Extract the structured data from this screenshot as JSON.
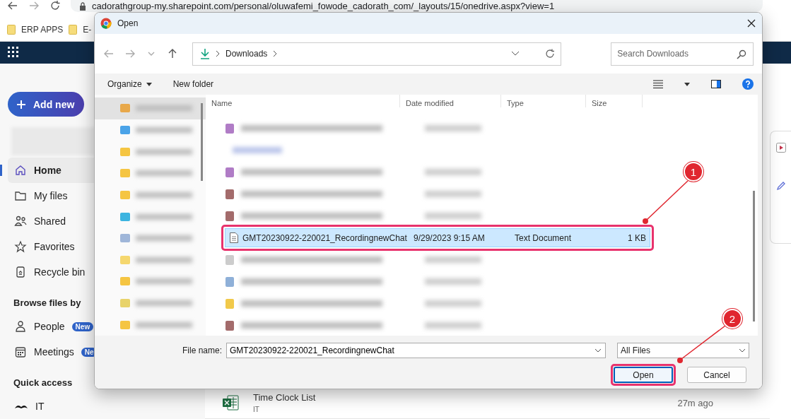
{
  "browser": {
    "url": "cadorathgroup-my.sharepoint.com/personal/oluwafemi_fowode_cadorath_com/_layouts/15/onedrive.aspx?view=1",
    "bookmarks": [
      "ERP APPS",
      "E-"
    ]
  },
  "sidebar": {
    "add_button": "Add new",
    "nav": [
      {
        "label": "Home",
        "selected": true
      },
      {
        "label": "My files",
        "selected": false
      },
      {
        "label": "Shared",
        "selected": false
      },
      {
        "label": "Favorites",
        "selected": false
      },
      {
        "label": "Recycle bin",
        "selected": false
      }
    ],
    "browse_heading": "Browse files by",
    "browse": [
      {
        "label": "People",
        "badge": "New"
      },
      {
        "label": "Meetings",
        "badge": "Ne"
      }
    ],
    "quick_heading": "Quick access",
    "quick": [
      {
        "label": "IT"
      }
    ]
  },
  "content": {
    "rows": [
      {
        "name": "Time Clock List",
        "location": "IT",
        "time": "27m ago"
      }
    ]
  },
  "dialog": {
    "title": "Open",
    "path": "Downloads",
    "search_placeholder": "Search Downloads",
    "toolbar": [
      "Organize",
      "New folder"
    ],
    "nav_pane": [
      {
        "color": "#e8a84a",
        "selected": true
      },
      {
        "color": "#4aa3e8",
        "selected": false
      },
      {
        "color": "#f5c542",
        "selected": false
      },
      {
        "color": "#f5c542",
        "selected": false
      },
      {
        "color": "#f5c542",
        "selected": false
      },
      {
        "color": "#3cb4e0",
        "selected": false
      },
      {
        "color": "#9fb6d9",
        "selected": false
      },
      {
        "color": "#f5d76e",
        "selected": false
      },
      {
        "color": "#f5c542",
        "selected": false
      },
      {
        "color": "#e8d36a",
        "selected": false
      },
      {
        "color": "#f5c542",
        "selected": false
      }
    ],
    "columns": [
      "Name",
      "Date modified",
      "Type",
      "Size"
    ],
    "rows": [
      {
        "kind": "blurred",
        "color": "#b07cc6"
      },
      {
        "kind": "group"
      },
      {
        "kind": "blurred",
        "color": "#b07cc6"
      },
      {
        "kind": "blurred",
        "color": "#a36b6b"
      },
      {
        "kind": "blurred",
        "color": "#a36b6b"
      },
      {
        "kind": "file",
        "name": "GMT20230922-220021_RecordingnewChat",
        "date": "9/29/2023 9:15 AM",
        "type": "Text Document",
        "size": "1 KB",
        "selected": true,
        "highlighted": true
      },
      {
        "kind": "blurred",
        "color": "#cccccc"
      },
      {
        "kind": "blurred",
        "color": "#8fb0d8"
      },
      {
        "kind": "blurred",
        "color": "#f1c94a"
      },
      {
        "kind": "blurred",
        "color": "#a36b6b"
      }
    ],
    "file_name_label": "File name:",
    "file_name": "GMT20230922-220021_RecordingnewChat",
    "file_type": "All Files",
    "buttons": [
      {
        "label": "Open",
        "kind": "default",
        "highlighted": true
      },
      {
        "label": "Cancel",
        "kind": "normal",
        "highlighted": false
      }
    ]
  },
  "callouts": [
    "1",
    "2"
  ]
}
